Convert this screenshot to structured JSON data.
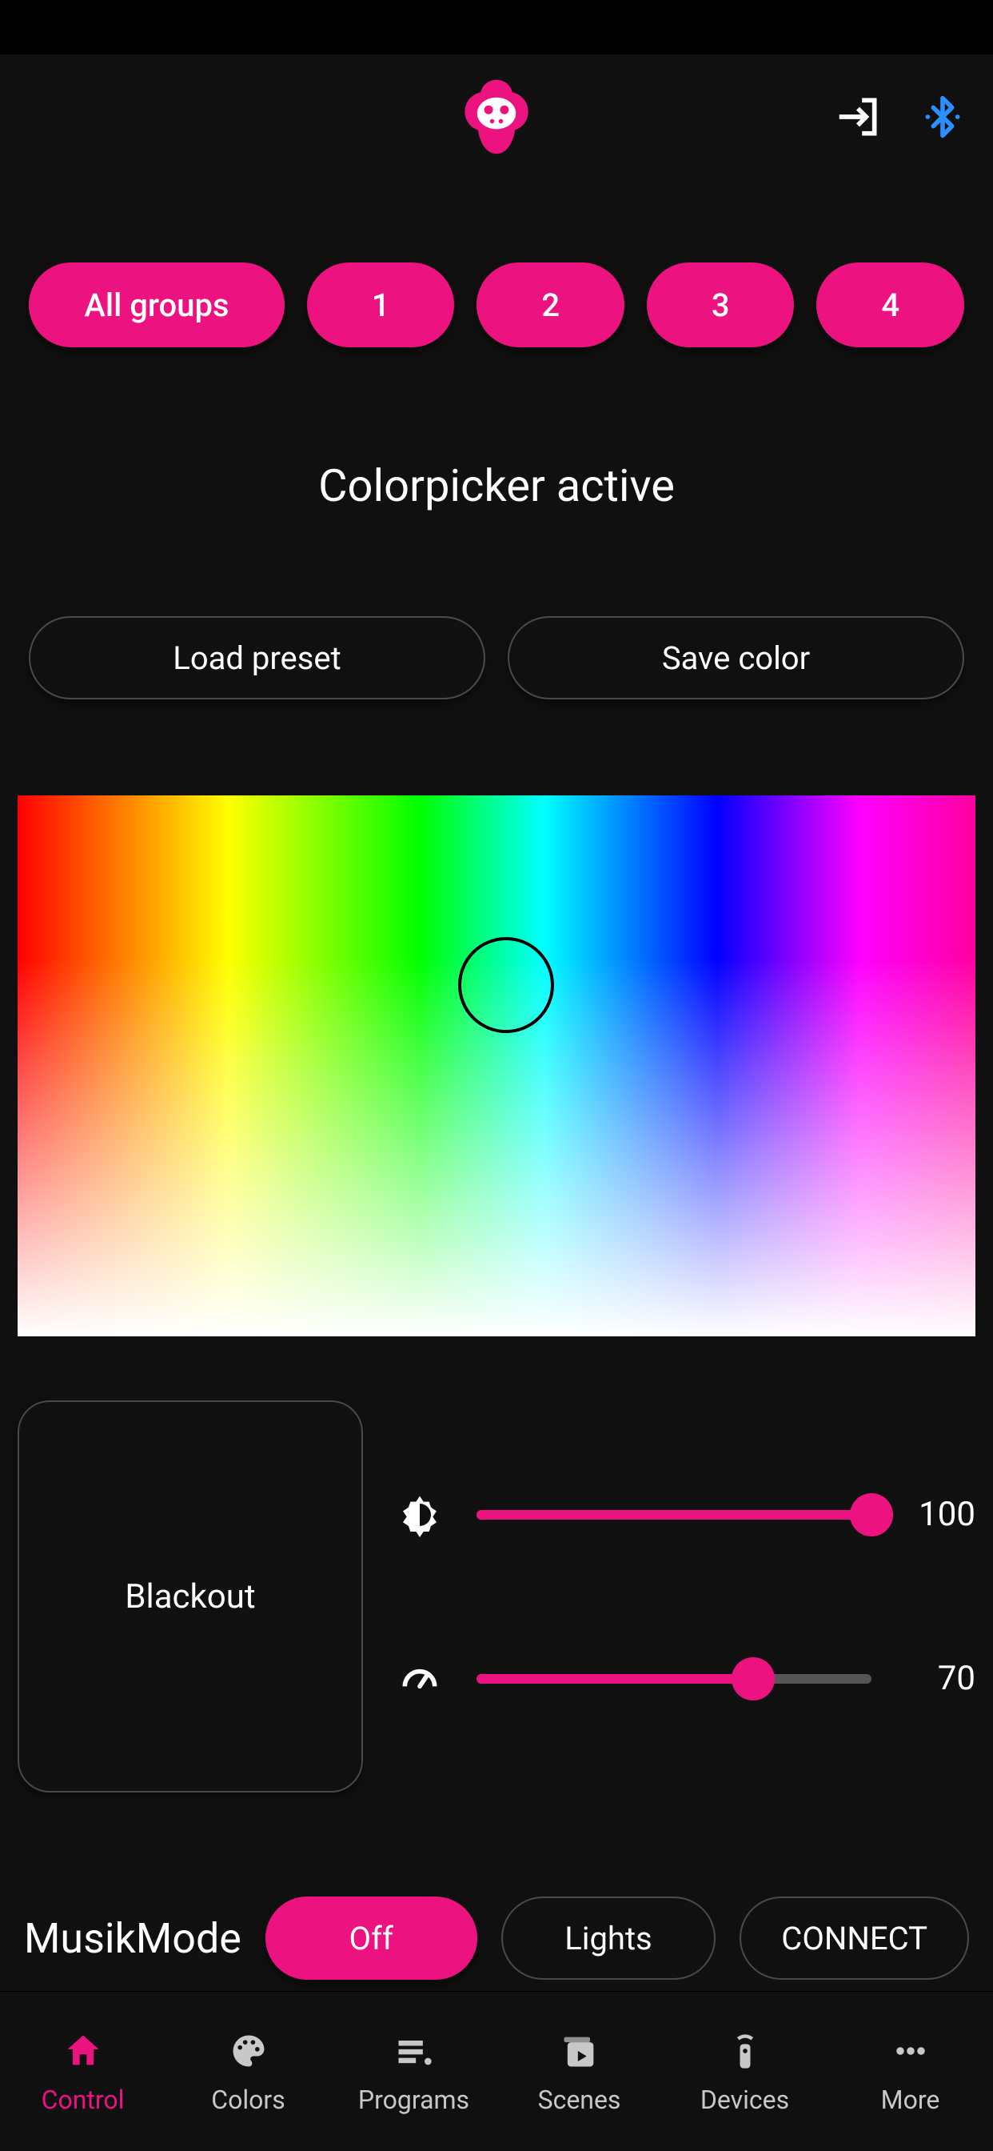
{
  "colors": {
    "accent": "#EC1280",
    "bluetooth": "#2B8FFF"
  },
  "header": {
    "logo_name": "monkey-logo",
    "exit_icon": "exit-icon",
    "bluetooth_icon": "bluetooth-icon"
  },
  "groups": {
    "all_label": "All groups",
    "items": [
      "1",
      "2",
      "3",
      "4"
    ]
  },
  "title": "Colorpicker active",
  "preset": {
    "load_label": "Load preset",
    "save_label": "Save color"
  },
  "blackout_label": "Blackout",
  "sliders": {
    "brightness": {
      "value": 100,
      "display": "100"
    },
    "speed": {
      "value": 70,
      "display": "70"
    }
  },
  "music": {
    "label": "MusikMode",
    "off": "Off",
    "lights": "Lights",
    "connect": "CONNECT"
  },
  "nav": {
    "control": "Control",
    "colors": "Colors",
    "programs": "Programs",
    "scenes": "Scenes",
    "devices": "Devices",
    "more": "More"
  }
}
